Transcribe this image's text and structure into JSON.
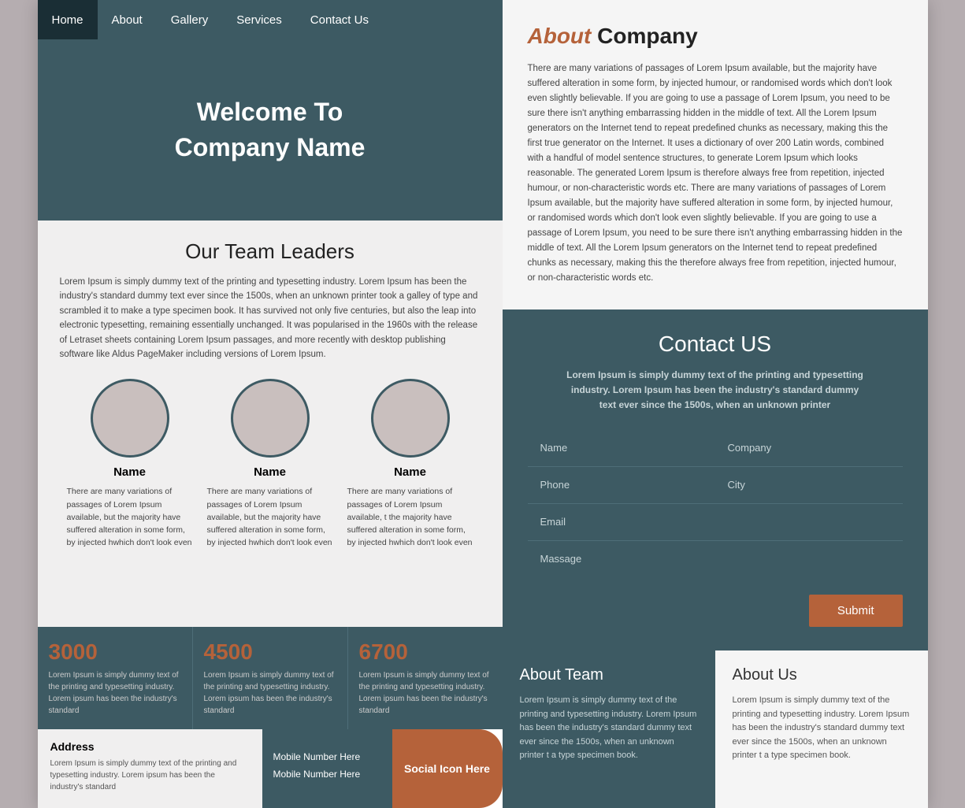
{
  "nav": {
    "items": [
      {
        "label": "Home",
        "active": true
      },
      {
        "label": "About",
        "active": false
      },
      {
        "label": "Gallery",
        "active": false
      },
      {
        "label": "Services",
        "active": false
      },
      {
        "label": "Contact Us",
        "active": false
      }
    ]
  },
  "hero": {
    "line1": "Welcome To",
    "line2": "Company Name"
  },
  "team": {
    "heading": "Our Team Leaders",
    "description": "Lorem Ipsum is simply dummy text of the printing and typesetting industry. Lorem Ipsum has been the industry's standard dummy text ever since the 1500s, when an unknown printer took a galley of type and scrambled it to make a type specimen book. It has survived not only five centuries, but also the leap into electronic typesetting, remaining essentially unchanged. It was popularised in the 1960s with the release of Letraset sheets containing Lorem Ipsum passages, and more recently with desktop publishing software like Aldus PageMaker including versions of Lorem Ipsum.",
    "members": [
      {
        "name": "Name",
        "description": "There are many variations of passages of Lorem Ipsum available, but the majority have suffered alteration in some form, by injected hwhich don't look even"
      },
      {
        "name": "Name",
        "description": "There are many variations of passages of Lorem Ipsum available, but the majority have suffered alteration in some form, by injected hwhich don't look even"
      },
      {
        "name": "Name",
        "description": "There are many variations of passages of Lorem Ipsum available, t the majority have suffered alteration in some form, by injected hwhich don't look even"
      }
    ]
  },
  "stats": [
    {
      "number": "3000",
      "description": "Lorem Ipsum is simply dummy text of the printing and typesetting industry. Lorem ipsum has been the industry's standard"
    },
    {
      "number": "4500",
      "description": "Lorem Ipsum is simply dummy text of the printing and typesetting industry. Lorem ipsum has been the industry's standard"
    },
    {
      "number": "6700",
      "description": "Lorem Ipsum is simply dummy text of the printing and typesetting industry. Lorem ipsum has been the industry's standard"
    }
  ],
  "footer": {
    "address_title": "Address",
    "address_text": "Lorem Ipsum is simply dummy text of the printing and typesetting industry. Lorem ipsum has been the industry's standard",
    "mobile_lines": [
      "Mobile Number Here",
      "Mobile Number Here"
    ],
    "social_text": "Social  Icon Here"
  },
  "about_company": {
    "title_highlight": "About",
    "title_rest": " Company",
    "text": "There are many variations of passages of Lorem Ipsum available, but the majority have suffered alteration in some form, by injected humour, or randomised words which don't look even slightly believable. If you are going to use a passage of Lorem Ipsum, you need to be sure there isn't anything embarrassing hidden in the middle of text. All the Lorem Ipsum generators on the Internet tend to repeat predefined chunks as necessary, making this the first true generator on the Internet. It uses a dictionary of over 200 Latin words, combined with a handful of model sentence structures, to generate Lorem Ipsum which looks reasonable. The generated Lorem Ipsum is therefore always free from repetition, injected humour, or non-characteristic words etc. There are many variations of passages of Lorem Ipsum available, but the majority have suffered alteration in some form, by injected humour, or randomised words which don't look even slightly believable. If you are going to use a passage of Lorem Ipsum, you need to be sure there isn't anything embarrassing hidden in the middle of text. All the Lorem Ipsum generators on the Internet tend to repeat predefined chunks as necessary, making this the therefore always free from repetition, injected humour, or non-characteristic words etc."
  },
  "contact": {
    "heading": "Contact US",
    "subtitle": "Lorem Ipsum is simply dummy text of the printing and typesetting industry. Lorem Ipsum has been the industry's standard dummy text ever since the 1500s, when an unknown printer",
    "fields": [
      {
        "label": "Name",
        "col": "half"
      },
      {
        "label": "Company",
        "col": "half"
      },
      {
        "label": "Phone",
        "col": "half"
      },
      {
        "label": "City",
        "col": "half"
      },
      {
        "label": "Email",
        "col": "full"
      },
      {
        "label": "Massage",
        "col": "full"
      }
    ],
    "submit_label": "Submit"
  },
  "about_team": {
    "title": "About Team",
    "text": "Lorem Ipsum is simply dummy text of the printing and typesetting industry. Lorem Ipsum has been the industry's standard dummy text ever since the 1500s, when an unknown printer t a type specimen book."
  },
  "about_us": {
    "title": "About Us",
    "text": "Lorem Ipsum is simply dummy text of the printing and typesetting industry. Lorem Ipsum has been the industry's standard dummy text ever since the 1500s, when an unknown printer t a type specimen book."
  }
}
